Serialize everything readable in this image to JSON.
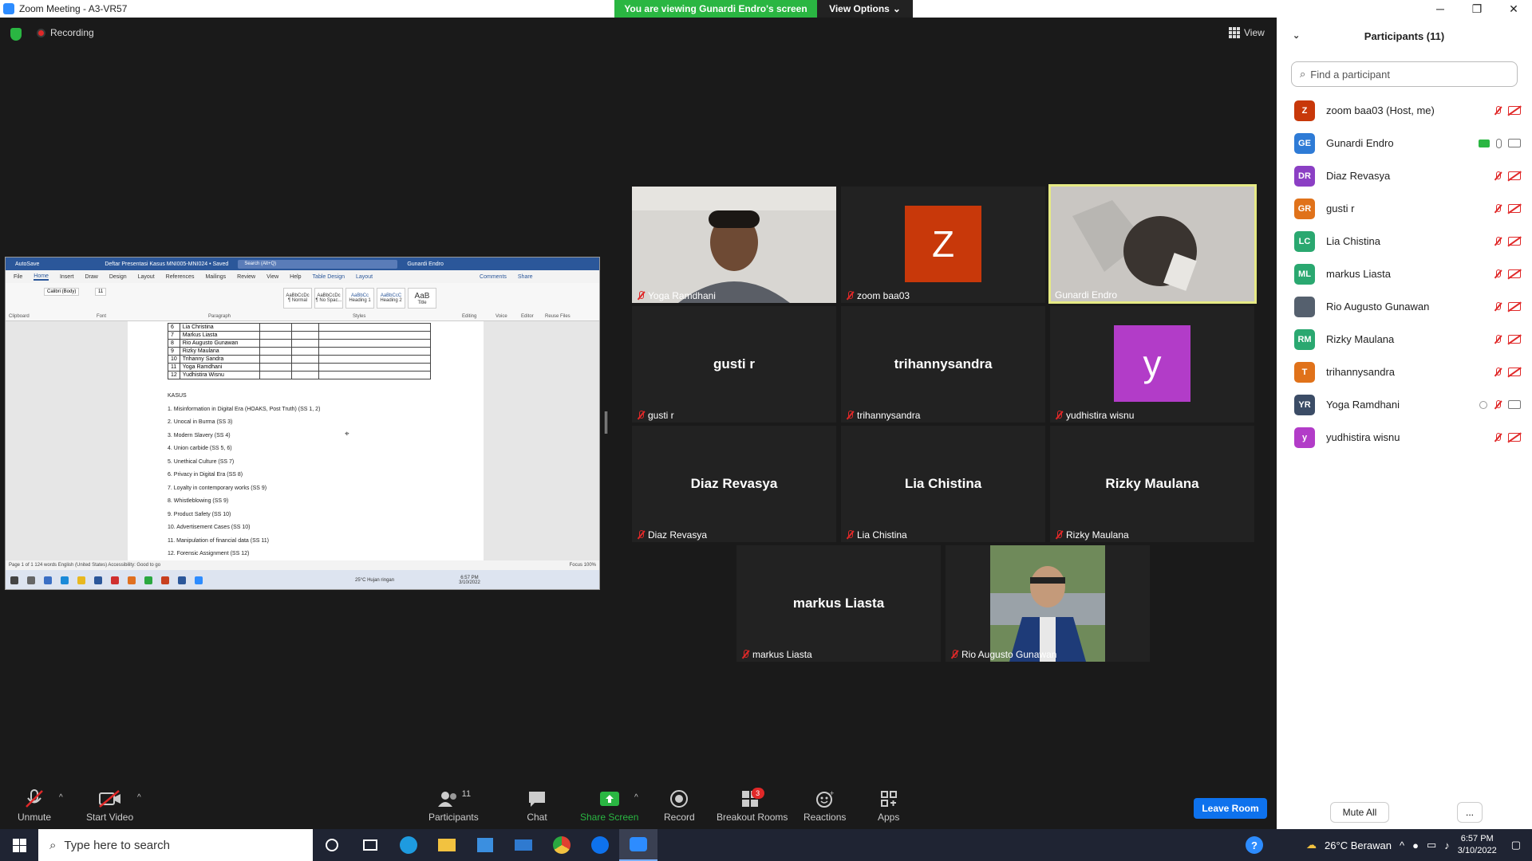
{
  "window": {
    "title": "Zoom Meeting - A3-VR57",
    "minimize": "─",
    "restore": "❐",
    "close": "✕"
  },
  "banner": {
    "viewing": "You are viewing Gunardi Endro's screen",
    "view_options": "View Options"
  },
  "topbar": {
    "recording": "Recording",
    "view": "View"
  },
  "shared_screen": {
    "title": "Deftar Presentasi Kasus MNI005-MNI024 • Saved",
    "search": "Search (Alt+Q)",
    "user": "Gunardi Endro",
    "autosave": "AutoSave",
    "tabs": [
      "File",
      "Home",
      "Insert",
      "Draw",
      "Design",
      "Layout",
      "References",
      "Mailings",
      "Review",
      "View",
      "Help",
      "Table Design",
      "Layout"
    ],
    "comments": "Comments",
    "share": "Share",
    "font_name": "Calibri (Body)",
    "font_size": "11",
    "styles": [
      "AaBbCcDc",
      "AaBbCcDc",
      "AaBbCc",
      "AaBbCcC",
      "AaB"
    ],
    "style_names": [
      "¶ Normal",
      "¶ No Spac...",
      "Heading 1",
      "Heading 2",
      "Title"
    ],
    "groups": [
      "Clipboard",
      "Font",
      "Paragraph",
      "Styles",
      "Editing",
      "Voice",
      "Editor",
      "Reuse Files"
    ],
    "table_rows": [
      [
        "6",
        "Lia Christina"
      ],
      [
        "7",
        "Markus Liasta"
      ],
      [
        "8",
        "Rio Augusto Gunawan"
      ],
      [
        "9",
        "Rizky Maulana"
      ],
      [
        "10",
        "Trihanny Sandra"
      ],
      [
        "11",
        "Yoga Ramdhani"
      ],
      [
        "12",
        "Yudhistira Wisnu"
      ]
    ],
    "kasus_title": "KASUS",
    "kasus": [
      "1. Misinformation in Digital Era (HOAKS, Post Truth) (SS 1, 2)",
      "2. Unocal in Burma (SS 3)",
      "3. Modern Slavery (SS 4)",
      "4. Union carbide (SS 5, 6)",
      "5. Unethical Culture (SS 7)",
      "6. Privacy in Digital Era (SS 8)",
      "7. Loyalty in contemporary works (SS 9)",
      "8. Whistleblowing (SS 9)",
      "9. Product Safety (SS 10)",
      "10. Advertisement Cases (SS 10)",
      "11. Manipulation of financial data (SS 11)",
      "12. Forensic Assignment (SS 12)"
    ],
    "status": "Page 1 of 1     124 words     English (United States)     Accessibility: Good to go",
    "status_right": "Focus     100%",
    "task_weather": "25°C  Hujan ringan",
    "task_time": "6:57 PM",
    "task_date": "3/10/2022"
  },
  "tiles": [
    {
      "name": "Yoga Ramdhani",
      "kind": "video"
    },
    {
      "name": "zoom baa03",
      "kind": "avatar",
      "letter": "Z",
      "color": "#c8380a"
    },
    {
      "name": "Gunardi Endro",
      "kind": "video",
      "active": true
    },
    {
      "name": "gusti r",
      "kind": "text"
    },
    {
      "name": "trihannysandra",
      "kind": "text"
    },
    {
      "name": "yudhistira wisnu",
      "kind": "avatar",
      "letter": "y",
      "color": "#b23cc8"
    },
    {
      "name": "Diaz Revasya",
      "kind": "text"
    },
    {
      "name": "Lia Chistina",
      "kind": "text"
    },
    {
      "name": "Rizky Maulana",
      "kind": "text"
    },
    {
      "name": "markus Liasta",
      "kind": "text"
    },
    {
      "name": "Rio Augusto Gunawan",
      "kind": "video"
    }
  ],
  "panel": {
    "title": "Participants (11)",
    "search_placeholder": "Find a participant",
    "participants": [
      {
        "initials": "Z",
        "name": "zoom baa03 (Host, me)",
        "color": "#c8380a"
      },
      {
        "initials": "GE",
        "name": "Gunardi Endro",
        "color": "#2e7bd6"
      },
      {
        "initials": "DR",
        "name": "Diaz Revasya",
        "color": "#8b3fc4"
      },
      {
        "initials": "GR",
        "name": "gusti r",
        "color": "#e0721a"
      },
      {
        "initials": "LC",
        "name": "Lia Chistina",
        "color": "#2aa870"
      },
      {
        "initials": "ML",
        "name": "markus Liasta",
        "color": "#2aa870"
      },
      {
        "initials": "",
        "name": "Rio Augusto Gunawan",
        "color": "#55606e"
      },
      {
        "initials": "RM",
        "name": "Rizky Maulana",
        "color": "#2aa870"
      },
      {
        "initials": "T",
        "name": "trihannysandra",
        "color": "#e0721a"
      },
      {
        "initials": "YR",
        "name": "Yoga Ramdhani",
        "color": "#3b4c66"
      },
      {
        "initials": "y",
        "name": "yudhistira wisnu",
        "color": "#b23cc8"
      }
    ],
    "mute_all": "Mute All",
    "more": "..."
  },
  "toolbar": {
    "unmute": "Unmute",
    "start_video": "Start Video",
    "participants": "Participants",
    "participants_count": "11",
    "chat": "Chat",
    "share_screen": "Share Screen",
    "record": "Record",
    "breakout": "Breakout Rooms",
    "breakout_badge": "3",
    "reactions": "Reactions",
    "apps": "Apps",
    "leave": "Leave Room"
  },
  "taskbar": {
    "search_placeholder": "Type here to search",
    "weather": "26°C  Berawan",
    "time": "6:57 PM",
    "date": "3/10/2022"
  },
  "colors": {
    "accent": "#0e72ed",
    "banner": "#2ab642",
    "muted": "#e02828",
    "active_speaker": "#e6ea84"
  }
}
